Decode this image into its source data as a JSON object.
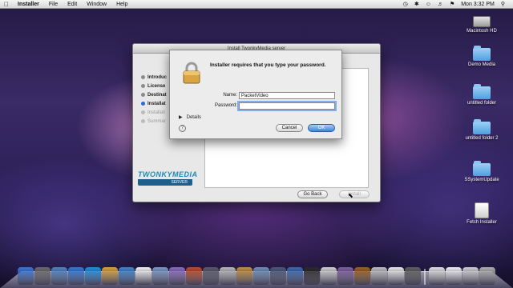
{
  "menubar": {
    "app_name": "Installer",
    "menus": [
      "File",
      "Edit",
      "Window",
      "Help"
    ],
    "clock": "Mon 3:32 PM"
  },
  "installer": {
    "title": "Install TwonkyMedia server",
    "steps": [
      {
        "label": "Introduc",
        "state": "done"
      },
      {
        "label": "License",
        "state": "done"
      },
      {
        "label": "Destinat",
        "state": "done"
      },
      {
        "label": "Installat",
        "state": "current"
      },
      {
        "label": "Installati",
        "state": "pending"
      },
      {
        "label": "Summar",
        "state": "pending"
      }
    ],
    "logo_text": "TWONKYMEDIA",
    "logo_sub": "SERVER",
    "go_back": "Go Back",
    "install": "Install"
  },
  "auth": {
    "message": "Installer requires that you type your password.",
    "name_label": "Name:",
    "name_value": "PacketVideo",
    "password_label": "Password:",
    "password_value": "",
    "details": "Details",
    "cancel": "Cancel",
    "ok": "OK",
    "help": "?"
  },
  "desktop_icons": [
    {
      "label": "Macintosh HD",
      "icon": "hard-drive-icon"
    },
    {
      "label": "Demo Media",
      "icon": "folder-icon"
    },
    {
      "label": "untitled folder",
      "icon": "folder-icon"
    },
    {
      "label": "untitled folder 2",
      "icon": "folder-icon"
    },
    {
      "label": "SSystemUpdate",
      "icon": "folder-icon"
    },
    {
      "label": "Fetch Installer",
      "icon": "package-icon"
    }
  ],
  "dock": {
    "colors": [
      "#3a78d8",
      "#6b6b6b",
      "#4f84c4",
      "#2f7ad8",
      "#1f8fe0",
      "#d9a23c",
      "#3e86d0",
      "#f2f2f2",
      "#7b9ac8",
      "#8a6cc0",
      "#c04a2a",
      "#5a5a6a",
      "#b8b8b8",
      "#c09040",
      "#6c8fb8",
      "#4a5a7a",
      "#3a6ab0",
      "#2a2a2a",
      "#d0d0d0",
      "#8060a0",
      "#a06020",
      "#c0c0c0",
      "#e8e8e8",
      "#606060",
      "#e0e0e0",
      "#f0f0f0",
      "#d0d0d0",
      "#b0b0b0"
    ]
  }
}
